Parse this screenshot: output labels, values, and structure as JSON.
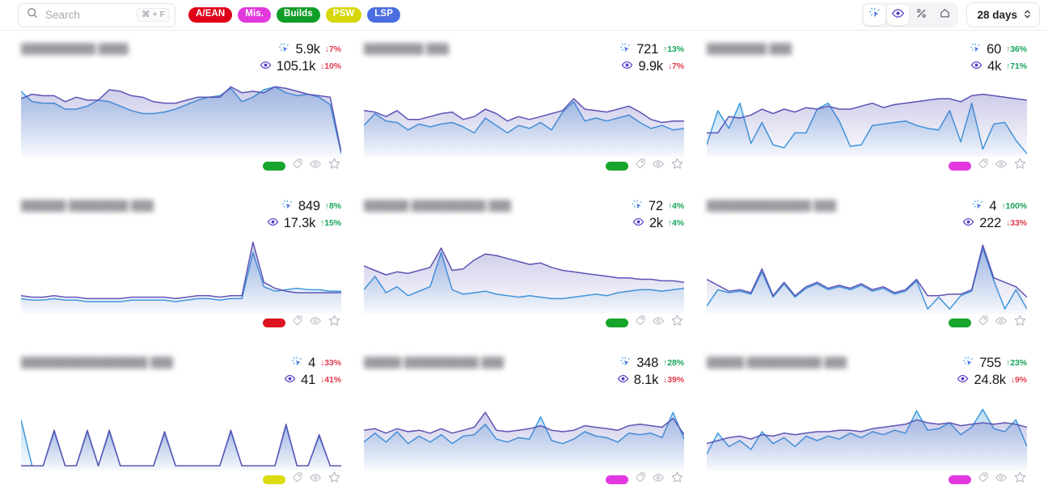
{
  "header": {
    "search": {
      "placeholder": "Search",
      "value": "",
      "shortcut": "⌘ + F",
      "icon": "search-icon"
    },
    "tags": [
      {
        "label": "A/EAN",
        "color": "#e00018"
      },
      {
        "label": "Mis.",
        "color": "#e239dd"
      },
      {
        "label": "Builds",
        "color": "#0f9d28"
      },
      {
        "label": "PSW",
        "color": "#d6d60a"
      },
      {
        "label": "LSP",
        "color": "#4a6ee0"
      }
    ],
    "tools": [
      {
        "name": "clicks-icon",
        "active": true
      },
      {
        "name": "views-icon",
        "active": true
      },
      {
        "name": "percent-icon",
        "active": false
      },
      {
        "name": "home-icon",
        "active": false
      }
    ],
    "range": {
      "label": "28 days",
      "icon": "chevron-updown-icon"
    }
  },
  "cards": [
    {
      "domain": "██████████ ████",
      "clicks": "5.9k",
      "clicks_delta": "7%",
      "clicks_dir": "down",
      "views": "105.1k",
      "views_delta": "10%",
      "views_dir": "down",
      "badge_color": "#17a52c"
    },
    {
      "domain": "████████ ███",
      "clicks": "721",
      "clicks_delta": "13%",
      "clicks_dir": "up",
      "views": "9.9k",
      "views_delta": "7%",
      "views_dir": "down",
      "badge_color": "#17a52c"
    },
    {
      "domain": "████████ ███",
      "clicks": "60",
      "clicks_delta": "36%",
      "clicks_dir": "up",
      "views": "4k",
      "views_delta": "71%",
      "views_dir": "up",
      "badge_color": "#e23ae0"
    },
    {
      "domain": "██████ ████████ ███",
      "clicks": "849",
      "clicks_delta": "8%",
      "clicks_dir": "up",
      "views": "17.3k",
      "views_delta": "15%",
      "views_dir": "up",
      "badge_color": "#dd1420"
    },
    {
      "domain": "██████ ██████████ ███",
      "clicks": "72",
      "clicks_delta": "4%",
      "clicks_dir": "up",
      "views": "2k",
      "views_delta": "4%",
      "views_dir": "up",
      "badge_color": "#17a52c"
    },
    {
      "domain": "██████████████ ███",
      "clicks": "4",
      "clicks_delta": "100%",
      "clicks_dir": "up",
      "views": "222",
      "views_delta": "33%",
      "views_dir": "down",
      "badge_color": "#17a52c"
    },
    {
      "domain": "█████████████████ ███",
      "clicks": "4",
      "clicks_delta": "33%",
      "clicks_dir": "down",
      "views": "41",
      "views_delta": "41%",
      "views_dir": "down",
      "badge_color": "#dbdb10"
    },
    {
      "domain": "█████ ██████████ ███",
      "clicks": "348",
      "clicks_delta": "28%",
      "clicks_dir": "up",
      "views": "8.1k",
      "views_delta": "39%",
      "views_dir": "down",
      "badge_color": "#e23ae0"
    },
    {
      "domain": "█████ ██████████ ███",
      "clicks": "755",
      "clicks_delta": "23%",
      "clicks_dir": "up",
      "views": "24.8k",
      "views_delta": "9%",
      "views_dir": "down",
      "badge_color": "#e23ae0"
    }
  ],
  "chart_data": {
    "type": "area",
    "title": "",
    "xlabel": "",
    "ylabel": "",
    "grid": false,
    "legend": null,
    "series_colors": {
      "views": "#5b55b5",
      "clicks": "#3e9ade"
    },
    "ylim": [
      0,
      100
    ],
    "charts": [
      {
        "card": 1,
        "views": [
          76,
          82,
          80,
          80,
          72,
          78,
          74,
          74,
          88,
          86,
          80,
          78,
          72,
          70,
          70,
          74,
          78,
          78,
          78,
          92,
          84,
          86,
          84,
          92,
          90,
          86,
          82,
          80,
          78,
          4
        ],
        "clicks": [
          86,
          72,
          70,
          70,
          62,
          62,
          66,
          74,
          72,
          66,
          60,
          56,
          56,
          58,
          62,
          68,
          74,
          78,
          80,
          90,
          72,
          78,
          88,
          92,
          84,
          80,
          82,
          78,
          68,
          2
        ]
      },
      {
        "card": 2,
        "views": [
          60,
          58,
          52,
          60,
          48,
          48,
          52,
          56,
          58,
          48,
          52,
          62,
          56,
          46,
          52,
          48,
          52,
          56,
          60,
          76,
          62,
          60,
          58,
          62,
          66,
          58,
          48,
          44,
          46,
          46
        ],
        "clicks": [
          40,
          56,
          46,
          44,
          34,
          42,
          38,
          42,
          44,
          38,
          30,
          50,
          40,
          30,
          40,
          36,
          44,
          34,
          58,
          72,
          46,
          50,
          46,
          50,
          54,
          44,
          36,
          40,
          34,
          36
        ]
      },
      {
        "card": 3,
        "views": [
          30,
          30,
          52,
          50,
          54,
          62,
          56,
          62,
          58,
          64,
          62,
          66,
          62,
          62,
          66,
          70,
          64,
          68,
          70,
          72,
          74,
          76,
          76,
          72,
          80,
          82,
          80,
          78,
          76,
          74
        ],
        "clicks": [
          14,
          60,
          36,
          70,
          16,
          44,
          14,
          10,
          30,
          30,
          62,
          70,
          46,
          12,
          14,
          40,
          42,
          44,
          46,
          40,
          36,
          34,
          60,
          18,
          70,
          8,
          42,
          44,
          20,
          2
        ]
      },
      {
        "card": 4,
        "views": [
          22,
          20,
          20,
          22,
          20,
          20,
          18,
          18,
          18,
          18,
          20,
          20,
          20,
          20,
          18,
          20,
          22,
          22,
          20,
          22,
          22,
          94,
          40,
          32,
          28,
          26,
          26,
          26,
          26,
          26
        ],
        "clicks": [
          18,
          16,
          16,
          18,
          16,
          16,
          14,
          14,
          14,
          14,
          16,
          16,
          16,
          16,
          14,
          16,
          18,
          18,
          16,
          18,
          18,
          80,
          34,
          28,
          30,
          32,
          30,
          30,
          28,
          28
        ]
      },
      {
        "card": 5,
        "views": [
          62,
          56,
          50,
          54,
          52,
          56,
          60,
          86,
          56,
          58,
          70,
          78,
          76,
          72,
          68,
          64,
          66,
          60,
          56,
          54,
          52,
          50,
          48,
          46,
          46,
          44,
          44,
          42,
          42,
          40
        ],
        "clicks": [
          30,
          48,
          26,
          34,
          22,
          28,
          34,
          80,
          30,
          24,
          26,
          28,
          24,
          22,
          20,
          22,
          20,
          18,
          18,
          20,
          22,
          24,
          22,
          26,
          28,
          30,
          30,
          28,
          30,
          32
        ]
      },
      {
        "card": 6,
        "views": [
          44,
          36,
          28,
          30,
          26,
          58,
          22,
          40,
          22,
          34,
          40,
          32,
          36,
          32,
          38,
          30,
          34,
          26,
          30,
          44,
          22,
          22,
          24,
          24,
          30,
          90,
          46,
          40,
          34,
          20
        ],
        "clicks": [
          8,
          30,
          26,
          28,
          24,
          54,
          20,
          38,
          20,
          32,
          38,
          30,
          34,
          30,
          36,
          28,
          32,
          24,
          28,
          42,
          4,
          20,
          4,
          22,
          28,
          86,
          42,
          4,
          30,
          4
        ]
      },
      {
        "card": 7,
        "views": [
          4,
          4,
          4,
          52,
          4,
          4,
          52,
          4,
          52,
          4,
          4,
          4,
          4,
          50,
          4,
          4,
          4,
          4,
          4,
          52,
          4,
          4,
          4,
          4,
          60,
          4,
          4,
          46,
          4,
          4
        ],
        "clicks": [
          66,
          4,
          4,
          50,
          4,
          4,
          50,
          4,
          50,
          4,
          4,
          4,
          4,
          48,
          4,
          4,
          4,
          4,
          4,
          50,
          4,
          4,
          4,
          4,
          58,
          4,
          4,
          44,
          4,
          4
        ]
      },
      {
        "card": 8,
        "views": [
          52,
          54,
          48,
          54,
          50,
          52,
          48,
          54,
          48,
          52,
          56,
          76,
          52,
          50,
          52,
          54,
          58,
          52,
          50,
          52,
          58,
          56,
          54,
          52,
          58,
          60,
          58,
          56,
          68,
          46
        ],
        "clicks": [
          36,
          48,
          36,
          50,
          34,
          44,
          36,
          46,
          34,
          44,
          46,
          60,
          40,
          36,
          42,
          40,
          70,
          38,
          34,
          40,
          50,
          44,
          42,
          36,
          48,
          46,
          48,
          42,
          76,
          40
        ]
      },
      {
        "card": 9,
        "views": [
          34,
          38,
          42,
          44,
          40,
          46,
          44,
          48,
          46,
          48,
          50,
          50,
          52,
          52,
          50,
          54,
          56,
          58,
          60,
          66,
          62,
          60,
          62,
          58,
          60,
          62,
          60,
          62,
          60,
          56
        ],
        "clicks": [
          20,
          48,
          30,
          38,
          26,
          50,
          34,
          42,
          30,
          44,
          38,
          44,
          40,
          48,
          42,
          50,
          46,
          52,
          48,
          78,
          52,
          54,
          62,
          46,
          56,
          80,
          54,
          50,
          66,
          30
        ]
      }
    ]
  }
}
